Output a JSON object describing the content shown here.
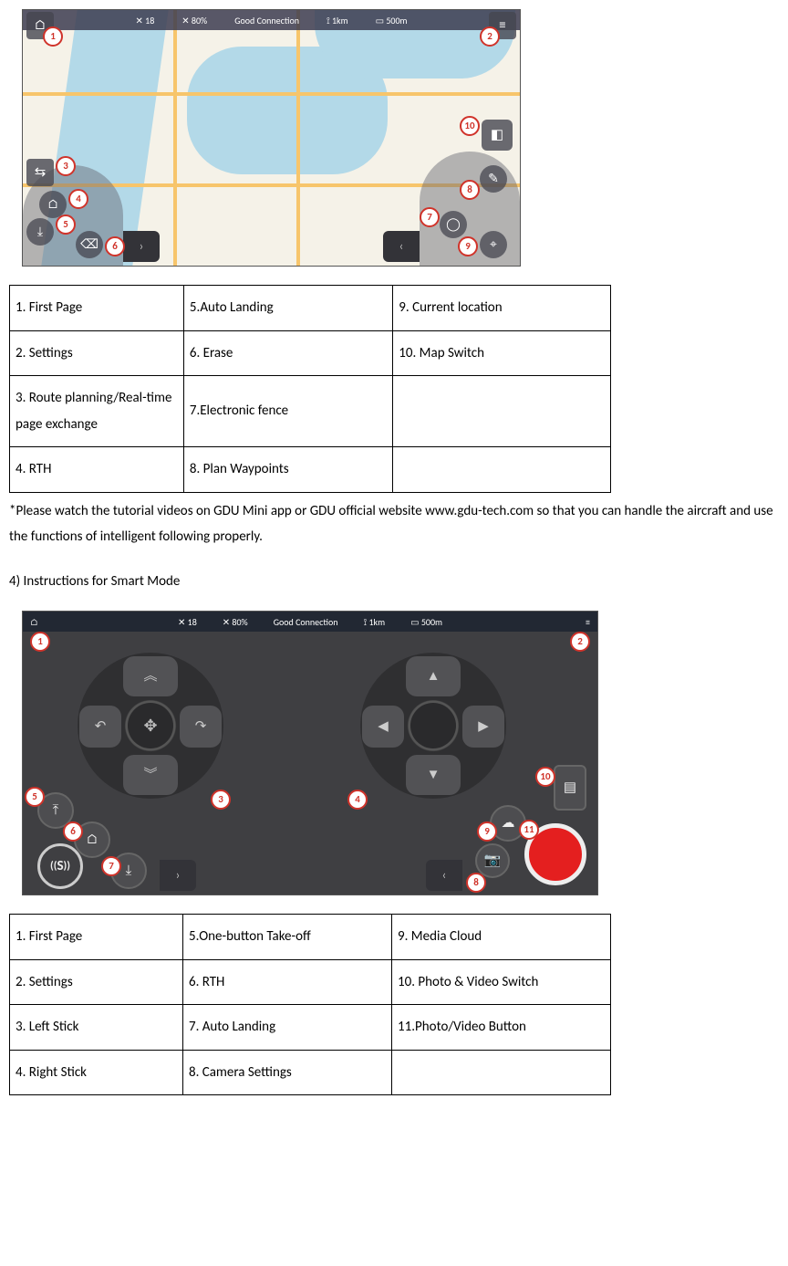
{
  "fig1": {
    "topbar_items": [
      "18",
      "80%",
      "Good Connection",
      "1km",
      "500m"
    ],
    "callouts": [
      "1",
      "2",
      "3",
      "4",
      "5",
      "6",
      "7",
      "8",
      "9",
      "10"
    ]
  },
  "table1": {
    "rows": [
      [
        "1. First Page",
        "5.Auto Landing",
        "9. Current location"
      ],
      [
        "2. Settings",
        "6. Erase",
        "10. Map Switch"
      ],
      [
        "3. Route planning/Real-time page exchange",
        "7.Electronic fence",
        ""
      ],
      [
        "4. RTH",
        "8. Plan Waypoints",
        ""
      ]
    ]
  },
  "note": "*Please watch the tutorial videos on GDU Mini app or GDU official website www.gdu-tech.com so that you can handle the aircraft and use the functions of intelligent following properly.",
  "heading": "4)    Instructions for Smart Mode",
  "fig2": {
    "topbar": {
      "sat": "18",
      "batt": "80%",
      "status": "Good Connection",
      "dist": "1km",
      "height": "500m"
    },
    "left_stick": {
      "up": "︽",
      "down": "︾",
      "left": "↶",
      "right": "↷",
      "hub": "✥"
    },
    "right_stick": {
      "up": "▲",
      "down": "▼",
      "left": "◀",
      "right": "▶",
      "hub": ""
    },
    "s_label": "S",
    "callouts": [
      "1",
      "2",
      "3",
      "4",
      "5",
      "6",
      "7",
      "8",
      "9",
      "10",
      "11"
    ]
  },
  "table2": {
    "rows": [
      [
        "1. First Page",
        "5.One-button Take-off",
        "9. Media Cloud"
      ],
      [
        "2. Settings",
        "6. RTH",
        "10. Photo & Video Switch"
      ],
      [
        "3. Left Stick",
        "7. Auto Landing",
        "11.Photo/Video Button"
      ],
      [
        "4. Right Stick",
        "8. Camera Settings",
        ""
      ]
    ]
  }
}
